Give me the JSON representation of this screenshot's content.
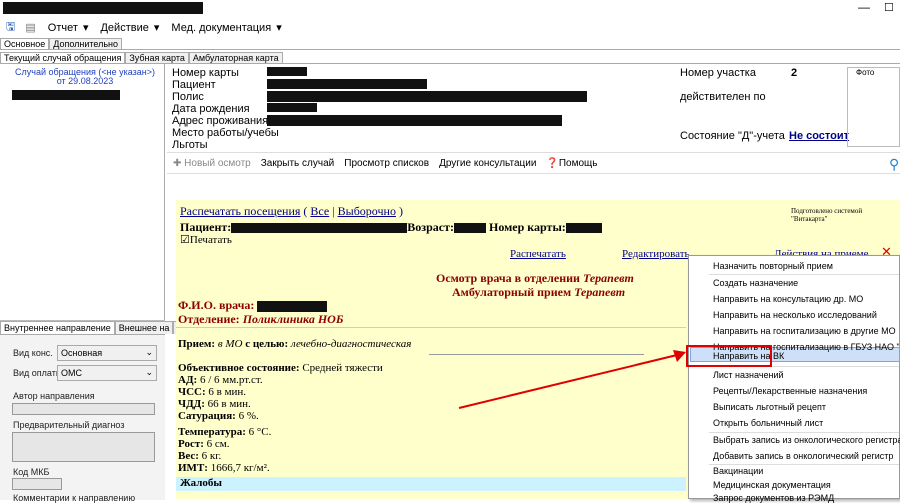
{
  "menu": {
    "report": "Отчет",
    "action": "Действие",
    "med_docs": "Мед. документация"
  },
  "tabs_top": [
    "Основное",
    "Дополнительно"
  ],
  "tabs_second": [
    "Текущий случай обращения",
    "Зубная карта",
    "Амбулаторная карта"
  ],
  "left": {
    "case_title": "Случай обращения (<не указан>)",
    "case_date": "от 29.08.2023",
    "subtabs": [
      "Внутреннее направление",
      "Внешнее на"
    ],
    "cons_label": "Вид конс.",
    "cons_value": "Основная",
    "pay_label": "Вид оплаты",
    "pay_value": "ОМС",
    "author_label": "Автор направления",
    "diag_label": "Предварительный диагноз",
    "mkb_label": "Код МКБ",
    "comment_label": "Комментарии к направлению"
  },
  "header": {
    "card_label": "Номер карты",
    "patient_label": "Пациент",
    "policy_label": "Полис",
    "dob_label": "Дата рождения",
    "address_label": "Адрес проживания",
    "work_label": "Место работы/учебы",
    "benefits_label": "Льготы",
    "district_label": "Номер участка",
    "district_value": "2",
    "valid_label": "действителен по",
    "d_status_label": "Состояние \"Д\"-учета",
    "d_status_value": "Не состоит",
    "photo_label": "Фото"
  },
  "toolbar": {
    "new_exam": "Новый осмотр",
    "close_case": "Закрыть случай",
    "view_lists": "Просмотр списков",
    "other_consult": "Другие консультации",
    "help": "Помощь"
  },
  "doc": {
    "print_visits": "Распечатать посещения",
    "all": "Все",
    "selective": "Выборочно",
    "prepared_by": "Подготовлено системой \"Витакарта\"",
    "patient_label": "Пациент:",
    "age_label": "Возраст:",
    "card_label": "Номер карты:",
    "print_check": "Печатать",
    "print_link": "Распечатать",
    "edit_link": "Редактировать",
    "actions_link": "Действия на приеме",
    "exam_title": "Осмотр врача в отделении",
    "exam_title_spec": "Терапевт",
    "exam_subtitle": "Амбулаторный прием",
    "exam_subtitle_spec": "Терапевт",
    "doctor_label": "Ф.И.О. врача:",
    "dept_label": "Отделение:",
    "dept_value": "Поликлиника НОБ",
    "reception_text": "Прием:",
    "reception_place": "в МО",
    "reception_goal_label": "с целью:",
    "reception_goal": "лечебно-диагностическая",
    "objective_label": "Объективное состояние:",
    "objective_value": "Средней тяжести",
    "ad_label": "АД:",
    "ad_value": "6 / 6 мм.рт.ст.",
    "chss_label": "ЧСС:",
    "chss_value": "6 в мин.",
    "chdd_label": "ЧДД:",
    "chdd_value": "66 в мин.",
    "sat_label": "Сатурация:",
    "sat_value": "6 %.",
    "temp_label": "Температура:",
    "temp_value": "6 °С.",
    "height_label": "Рост:",
    "height_value": "6 см.",
    "weight_label": "Вес:",
    "weight_value": "6 кг.",
    "imt_label": "ИМТ:",
    "imt_value": "1666,7 кг/м².",
    "complaints_label": "Жалобы"
  },
  "context_menu": [
    "Назначить повторный прием",
    "Создать назначение",
    "Направить на консультацию др. МО",
    "Направить на несколько исследований",
    "Направить на госпитализацию в другие МО",
    "Направить на госпитализацию в ГБУЗ НАО \"НЕНЕЦ",
    "Направить на ВК",
    "Лист назначений",
    "Рецепты/Лекарственные назначения",
    "Выписать льготный рецепт",
    "Открыть больничный лист",
    "Выбрать запись из онкологического регистра",
    "Добавить запись в онкологический регистр",
    "Вакцинации",
    "Медицинская документация",
    "Запрос документов из РЭМД"
  ],
  "colors": {
    "accent_red": "#e00000",
    "link": "#00008b",
    "doc_bg": "#ffffcc",
    "highlight": "#cde0f7"
  }
}
